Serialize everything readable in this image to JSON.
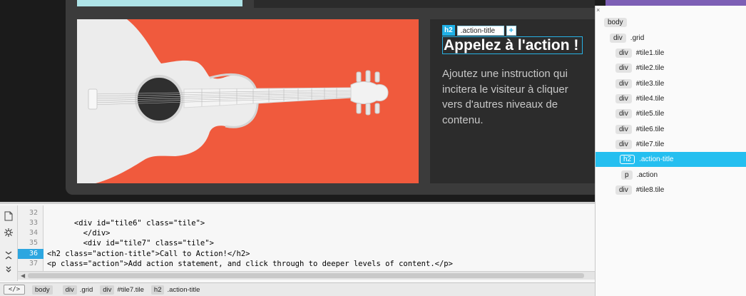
{
  "live_view": {
    "element_badge": {
      "tag": "h2",
      "class_name": ".action-title",
      "add": "+"
    },
    "action_title": "Appelez à l'action !",
    "action_text": "Ajoutez une instruction qui incitera le visiteur à cliquer vers d'autres niveaux de contenu."
  },
  "dom_panel": {
    "close": "×",
    "rows": [
      {
        "tag": "body",
        "label": ""
      },
      {
        "tag": "div",
        "label": ".grid"
      },
      {
        "tag": "div",
        "label": "#tile1.tile"
      },
      {
        "tag": "div",
        "label": "#tile2.tile"
      },
      {
        "tag": "div",
        "label": "#tile3.tile"
      },
      {
        "tag": "div",
        "label": "#tile4.tile"
      },
      {
        "tag": "div",
        "label": "#tile5.tile"
      },
      {
        "tag": "div",
        "label": "#tile6.tile"
      },
      {
        "tag": "div",
        "label": "#tile7.tile"
      },
      {
        "tag": "h2",
        "label": ".action-title"
      },
      {
        "tag": "p",
        "label": ".action"
      },
      {
        "tag": "div",
        "label": "#tile8.tile"
      }
    ]
  },
  "code_view": {
    "line_numbers": [
      "32",
      "33",
      "34",
      "35",
      "36",
      "37"
    ],
    "active_line": "36",
    "lines": [
      {
        "text": ""
      },
      {
        "text": "      <div id=\"tile6\" class=\"tile\">"
      },
      {
        "text": "        </div>"
      },
      {
        "text": "        <div id=\"tile7\" class=\"tile\">"
      },
      {
        "text": "<h2 class=\"action-title\">Call to Action!</h2>"
      },
      {
        "text": "<p class=\"action\">Add action statement, and click through to deeper levels of content.</p>"
      }
    ]
  },
  "breadcrumb": {
    "toggle": "</>",
    "items": [
      {
        "tag": "body",
        "label": ""
      },
      {
        "tag": "div",
        "label": ".grid"
      },
      {
        "tag": "div",
        "label": "#tile7.tile"
      },
      {
        "tag": "h2",
        "label": ".action-title"
      }
    ]
  },
  "colors": {
    "accent": "#25bff0",
    "tile_orange": "#f05a3d",
    "panel_dark": "#3b3b3b"
  }
}
